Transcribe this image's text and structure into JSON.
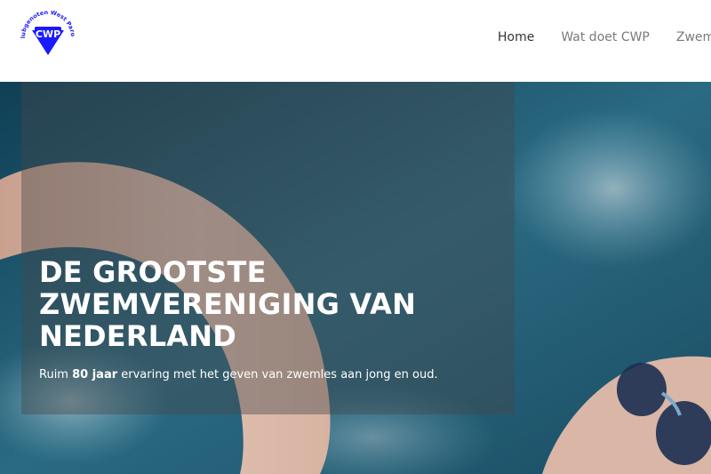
{
  "logo": {
    "alt_text": "Clubgenoten West Parool",
    "monogram": "CWP",
    "ring_text": "Clubgenoten West Parool",
    "color": "#1a1aff"
  },
  "nav": {
    "items": [
      {
        "label": "Home",
        "active": true
      },
      {
        "label": "Wat doet CWP",
        "active": false
      },
      {
        "label": "Zwemba",
        "active": false
      }
    ]
  },
  "hero": {
    "title": "DE GROOTSTE ZWEMVERENIGING VAN NEDERLAND",
    "subtitle_prefix": "Ruim ",
    "subtitle_bold": "80 jaar",
    "subtitle_suffix": " ervaring met het geven van zwemles aan jong en oud.",
    "image": "swimmer-freestyle-photo"
  },
  "colors": {
    "nav_text": "#7a7a7a",
    "nav_active": "#333333",
    "water": "#1d4f63",
    "panel": "rgba(70,72,74,0.42)"
  }
}
